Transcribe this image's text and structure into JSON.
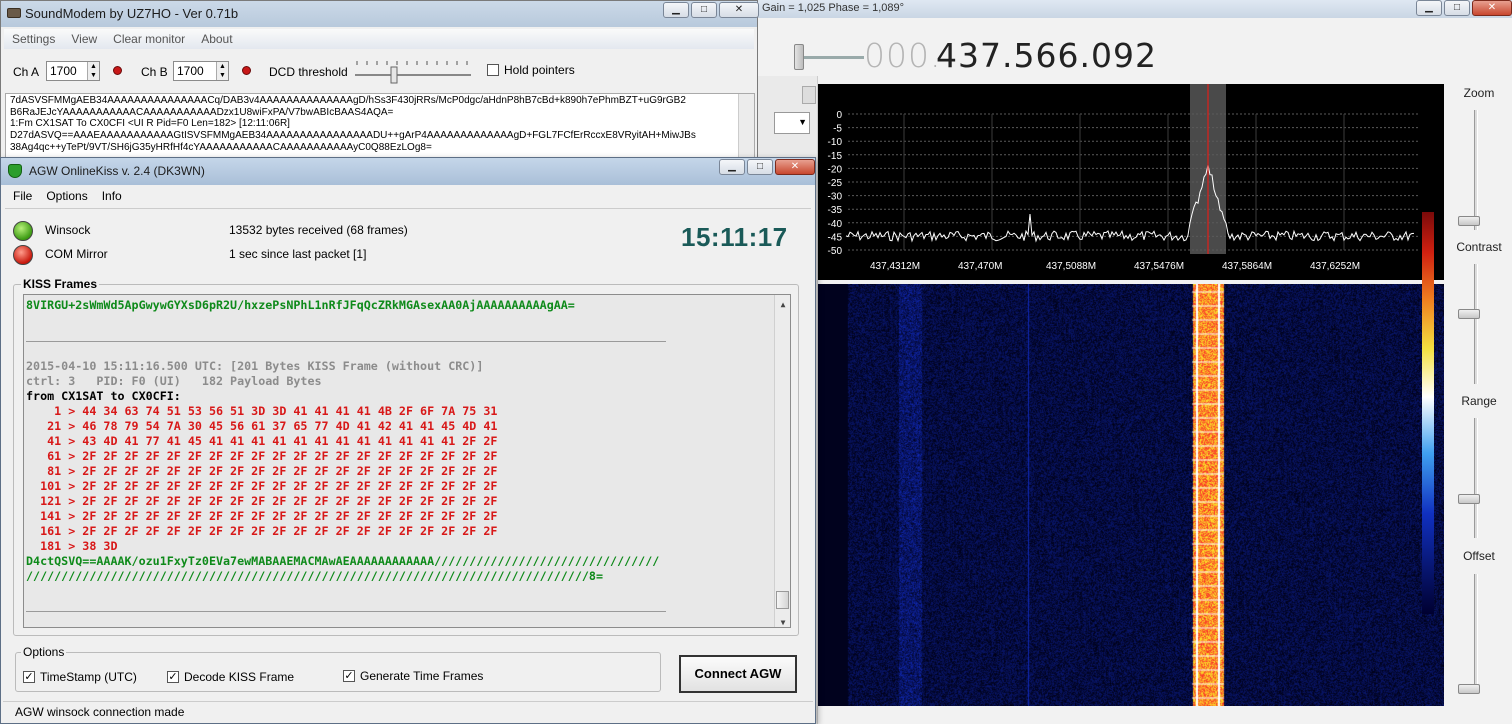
{
  "sdr": {
    "title": "Gain = 1,025 Phase = 1,089°",
    "freq_dim": "000.",
    "freq_main": "437.566.092",
    "controls": [
      "Zoom",
      "Contrast",
      "Range",
      "Offset"
    ],
    "spectrum": {
      "y_ticks": [
        "0",
        "-5",
        "-10",
        "-15",
        "-20",
        "-25",
        "-30",
        "-35",
        "-40",
        "-45",
        "-50"
      ],
      "x_ticks": [
        "437,4312M",
        "437,470M",
        "437,5088M",
        "437,5476M",
        "437,5864M",
        "437,6252M"
      ]
    }
  },
  "soundmodem": {
    "title": "SoundModem by UZ7HO - Ver 0.71b",
    "menu": [
      "Settings",
      "View",
      "Clear monitor",
      "About"
    ],
    "cha_label": "Ch A",
    "cha_value": "1700",
    "chb_label": "Ch B",
    "chb_value": "1700",
    "dcd_label": "DCD threshold",
    "hold_label": "Hold pointers",
    "monitor_lines": [
      "7dASVSFMMgAEB34AAAAAAAAAAAAAAACq/DAB3v4AAAAAAAAAAAAAAgD/hSs3F430jRRs/McP0dgc/aHdnP8hB7cBd+k890h7ePhmBZT+uG9rGB2",
      "B6RaJEJcYAAAAAAAAAAACAAAAAAAAAAADzx1U8wiFxPA/V7bwABIcBAAS4AQA=",
      "1:Fm CX1SAT To CX0CFI <UI R Pid=F0 Len=182> [12:11:06R]",
      "D27dASVQ==AAAEAAAAAAAAAAAGtISVSFMMgAEB34AAAAAAAAAAAAAAAADU++gArP4AAAAAAAAAAAAAgD+FGL7FCfErRccxE8VRyitAH+MiwJBs",
      "38Ag4qc++yTePt/9VT/SH6jG35yHRfHf4cYAAAAAAAAAAACAAAAAAAAAAAyC0Q88EzLOg8="
    ]
  },
  "agw": {
    "title": "AGW OnlineKiss v. 2.4  (DK3WN)",
    "menu": [
      "File",
      "Options",
      "Info"
    ],
    "winsock_label": "Winsock",
    "winsock_status": "13532 bytes received (68 frames)",
    "com_label": "COM Mirror",
    "com_status": "1 sec since last packet [1]",
    "clock": "15:11:17",
    "kiss_label": "KISS Frames",
    "console": {
      "top_line": "8VIRGU+2sWmWd5ApGwywGYXsD6pR2U/hxzePsNPhL1nRfJFqQcZRkMGAsexAA0AjAAAAAAAAAAgAA=",
      "header1": "2015-04-10 15:11:16.500 UTC: [201 Bytes KISS Frame (without CRC)]",
      "header2": "ctrl: 3   PID: F0 (UI)   182 Payload Bytes",
      "from": "from CX1SAT to CX0CFI:",
      "hex_rows": [
        "    1 > 44 34 63 74 51 53 56 51 3D 3D 41 41 41 41 4B 2F 6F 7A 75 31",
        "   21 > 46 78 79 54 7A 30 45 56 61 37 65 77 4D 41 42 41 41 45 4D 41",
        "   41 > 43 4D 41 77 41 45 41 41 41 41 41 41 41 41 41 41 41 41 2F 2F",
        "   61 > 2F 2F 2F 2F 2F 2F 2F 2F 2F 2F 2F 2F 2F 2F 2F 2F 2F 2F 2F 2F",
        "   81 > 2F 2F 2F 2F 2F 2F 2F 2F 2F 2F 2F 2F 2F 2F 2F 2F 2F 2F 2F 2F",
        "  101 > 2F 2F 2F 2F 2F 2F 2F 2F 2F 2F 2F 2F 2F 2F 2F 2F 2F 2F 2F 2F",
        "  121 > 2F 2F 2F 2F 2F 2F 2F 2F 2F 2F 2F 2F 2F 2F 2F 2F 2F 2F 2F 2F",
        "  141 > 2F 2F 2F 2F 2F 2F 2F 2F 2F 2F 2F 2F 2F 2F 2F 2F 2F 2F 2F 2F",
        "  161 > 2F 2F 2F 2F 2F 2F 2F 2F 2F 2F 2F 2F 2F 2F 2F 2F 2F 2F 2F 2F",
        "  181 > 38 3D"
      ],
      "b64_line1": "D4ctQSVQ==AAAAK/ozu1FxyTz0EVa7ewMABAAEMACMAwAEAAAAAAAAAAAA////////////////////////////////",
      "b64_line2": "////////////////////////////////////////////////////////////////////////////////8="
    },
    "options_label": "Options",
    "opt_timestamp": "TimeStamp (UTC)",
    "opt_decode": "Decode KISS Frame",
    "opt_generate": "Generate Time Frames",
    "connect_label": "Connect AGW",
    "statusbar": "AGW winsock connection made"
  }
}
